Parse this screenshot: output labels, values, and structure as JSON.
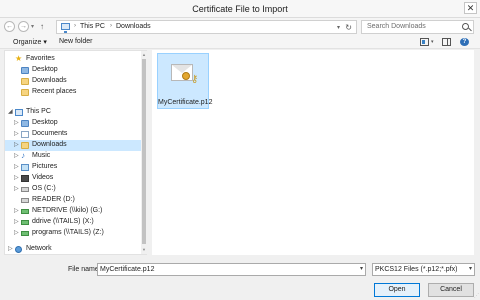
{
  "window": {
    "title": "Certificate File to Import",
    "close_glyph": "✕"
  },
  "nav": {
    "back_glyph": "←",
    "forward_glyph": "→",
    "recent_glyph": "▾",
    "up_glyph": "↑",
    "breadcrumb": [
      "This PC",
      "Downloads"
    ],
    "separator": "›",
    "dropdown_glyph": "▾",
    "refresh_glyph": "↻",
    "search_placeholder": "Search Downloads"
  },
  "toolbar": {
    "organize_label": "Organize ▾",
    "new_folder_label": "New folder",
    "help_glyph": "?",
    "view_caret": "▾"
  },
  "sidebar": {
    "scroll_up": "▲",
    "scroll_down": "▼",
    "items": [
      {
        "label": "Favorites",
        "icon": "star-icon",
        "caret": "",
        "level": 0
      },
      {
        "label": "Desktop",
        "icon": "folder-blue-icon",
        "caret": "",
        "level": 1
      },
      {
        "label": "Downloads",
        "icon": "folder-icon",
        "caret": "",
        "level": 1
      },
      {
        "label": "Recent places",
        "icon": "folder-icon",
        "caret": "",
        "level": 1
      },
      {
        "label": "This PC",
        "icon": "computer-icon",
        "caret": "◢",
        "level": 0
      },
      {
        "label": "Desktop",
        "icon": "folder-blue-icon",
        "caret": "▷",
        "level": 1
      },
      {
        "label": "Documents",
        "icon": "documents-icon",
        "caret": "▷",
        "level": 1
      },
      {
        "label": "Downloads",
        "icon": "folder-icon",
        "caret": "▷",
        "level": 1
      },
      {
        "label": "Music",
        "icon": "music-icon",
        "caret": "▷",
        "level": 1
      },
      {
        "label": "Pictures",
        "icon": "pictures-icon",
        "caret": "▷",
        "level": 1
      },
      {
        "label": "Videos",
        "icon": "videos-icon",
        "caret": "▷",
        "level": 1
      },
      {
        "label": "OS (C:)",
        "icon": "drive-icon",
        "caret": "▷",
        "level": 1
      },
      {
        "label": "READER (D:)",
        "icon": "drive-icon",
        "caret": "",
        "level": 1
      },
      {
        "label": "NETDRIVE (\\\\kilo) (G:)",
        "icon": "network-drive-icon",
        "caret": "▷",
        "level": 1
      },
      {
        "label": "ddrive (\\\\TAILS) (X:)",
        "icon": "network-drive-icon",
        "caret": "▷",
        "level": 1
      },
      {
        "label": "programs (\\\\TAILS) (Z:)",
        "icon": "network-drive-icon",
        "caret": "▷",
        "level": 1
      },
      {
        "label": "Network",
        "icon": "network-icon",
        "caret": "▷",
        "level": 0
      }
    ]
  },
  "files": [
    {
      "name": "MyCertificate.p12",
      "icon": "certificate-icon"
    }
  ],
  "footer": {
    "file_name_label": "File name:",
    "file_name_value": "MyCertificate.p12",
    "file_type_value": "PKCS12 Files (*.p12;*.pfx)",
    "dropdown_glyph": "▾",
    "open_label": "Open",
    "cancel_label": "Cancel",
    "grip_glyph": "⋰"
  }
}
